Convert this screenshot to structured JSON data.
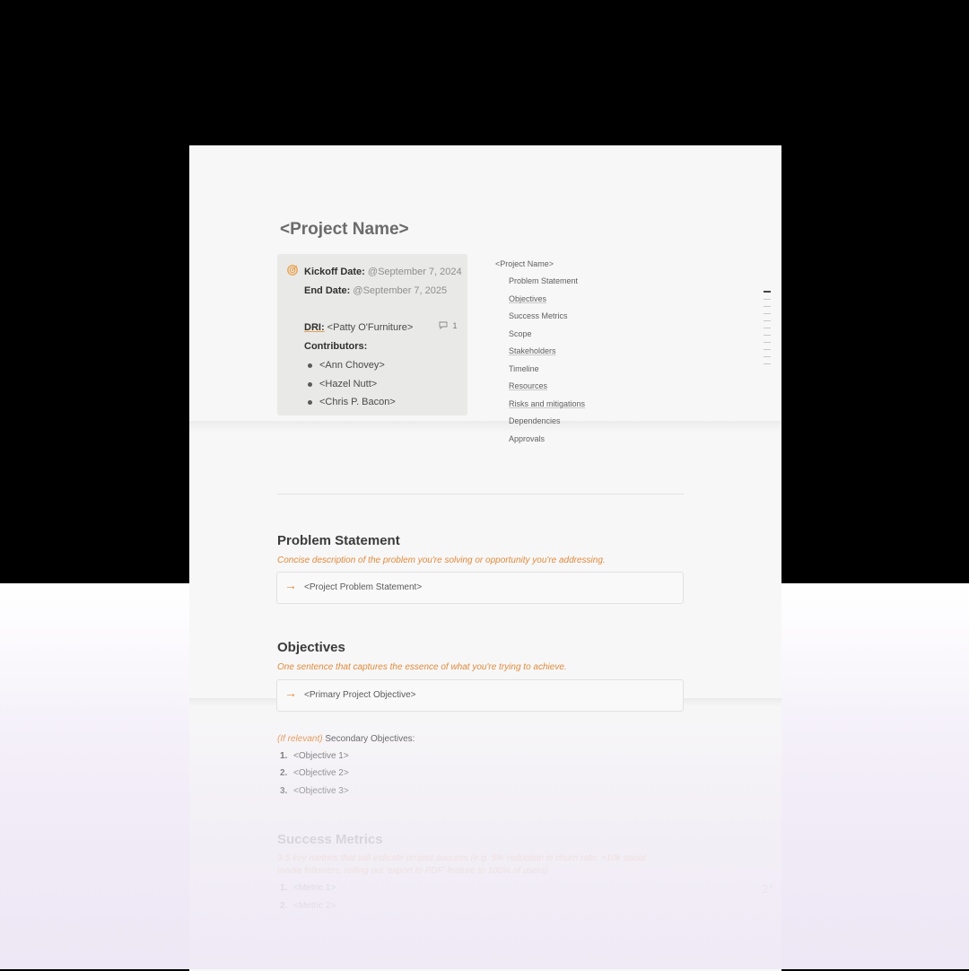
{
  "document": {
    "title": "<Project Name>",
    "callout": {
      "kickoff_label": "Kickoff Date:",
      "kickoff_value": "@September 7, 2024",
      "end_label": "End Date:",
      "end_value": "@September 7, 2025",
      "dri_label": "DRI:",
      "dri_value": "<Patty O'Furniture>",
      "comment_count": "1",
      "contributors_label": "Contributors:",
      "contributors": [
        "<Ann Chovey>",
        "<Hazel Nutt>",
        "<Chris P. Bacon>"
      ]
    },
    "toc": {
      "title": "<Project Name>",
      "items": [
        "Problem Statement",
        "Objectives",
        "Success Metrics",
        "Scope",
        "Stakeholders",
        "Timeline",
        "Resources",
        "Risks and mitigations",
        "Dependencies",
        "Approvals"
      ]
    },
    "problem": {
      "heading": "Problem Statement",
      "hint": "Concise description of the problem you're solving or opportunity you're addressing.",
      "box": "<Project Problem Statement>"
    },
    "objectives": {
      "heading": "Objectives",
      "hint": "One sentence that captures the essence of what you're trying to achieve.",
      "box": "<Primary Project Objective>",
      "secondary_prefix": "(If relevant)",
      "secondary_label": " Secondary Objectives:",
      "numbers": [
        "1.",
        "2.",
        "3."
      ],
      "list": [
        "<Objective 1>",
        "<Objective 2>",
        "<Objective 3>"
      ]
    },
    "metrics": {
      "heading": "Success Metrics",
      "hint_line1": "3-5 key metrics that will indicate project success (e.g. 5% reduction in churn rate, +10k social",
      "hint_line2": "media followers, rolling out 'export to PDF' feature to 100% of users)",
      "numbers": [
        "1.",
        "2."
      ],
      "list": [
        "<Metric 1>",
        "<Metric 2>"
      ]
    },
    "page_mark": "2°"
  },
  "colors": {
    "accent": "#e08a3c",
    "callout_bg": "#e9e9e7",
    "paper": "#f7f7f7"
  }
}
